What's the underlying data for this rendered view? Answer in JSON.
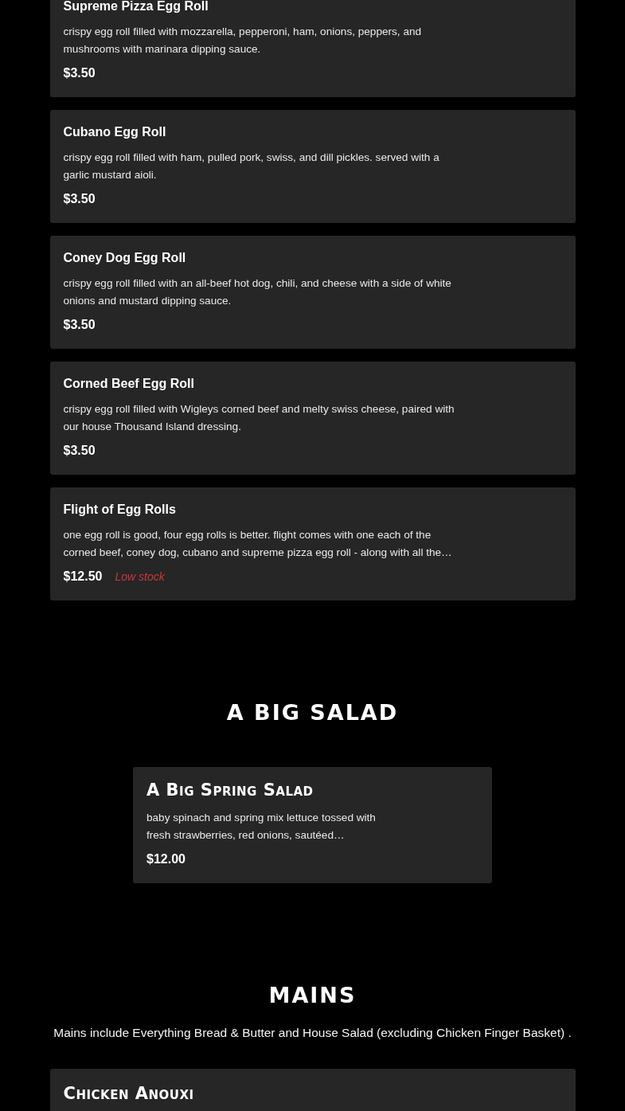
{
  "sections": [
    {
      "kind": "basic",
      "items": [
        {
          "name": "Supreme Pizza Egg Roll",
          "description": "crispy egg roll filled with mozzarella, pepperoni, ham, onions, peppers, and mushrooms with marinara dipping sauce.",
          "price": "$3.50"
        },
        {
          "name": "Cubano Egg Roll",
          "description": "crispy egg roll filled with ham, pulled pork, swiss, and dill pickles. served with a garlic mustard aioli.",
          "price": "$3.50"
        },
        {
          "name": "Coney Dog Egg Roll",
          "description": "crispy egg roll filled with an all-beef hot dog, chili, and cheese with a side of white onions and mustard dipping sauce.",
          "price": "$3.50"
        },
        {
          "name": "Corned Beef Egg Roll",
          "description": "crispy egg roll filled with Wigleys corned beef and melty swiss cheese, paired with our house Thousand Island dressing.",
          "price": "$3.50"
        },
        {
          "name": "Flight of Egg Rolls",
          "description": "one egg roll is good, four egg rolls is better. flight comes with one each of the corned beef, coney dog, cubano and supreme pizza egg roll - along with all the…",
          "price": "$12.50",
          "stock_note": "Low stock"
        }
      ]
    },
    {
      "kind": "narrow",
      "title": "A BIG SALAD",
      "items": [
        {
          "name": "A Big Spring Salad",
          "description": "baby spinach and spring mix lettuce tossed with fresh strawberries, red onions, sautéed…",
          "price": "$12.00"
        }
      ]
    },
    {
      "kind": "wide",
      "title": "MAINS",
      "note": "Mains include Everything Bread & Butter and House Salad (excluding Chicken Finger Basket) .",
      "items": [
        {
          "name": "Chicken Anouxi"
        }
      ]
    }
  ]
}
